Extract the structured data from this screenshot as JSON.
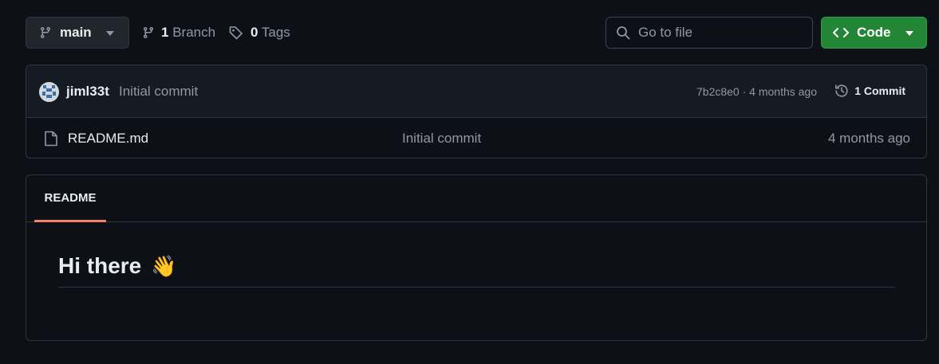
{
  "toolbar": {
    "branch": "main",
    "branches_count": "1",
    "branches_label": "Branch",
    "tags_count": "0",
    "tags_label": "Tags",
    "search_placeholder": "Go to file",
    "code_label": "Code"
  },
  "latest_commit": {
    "author": "jiml33t",
    "message": "Initial commit",
    "meta": "7b2c8e0 · 4 months ago",
    "count_label": "1 Commit"
  },
  "files": [
    {
      "name": "README.md",
      "commit": "Initial commit",
      "time": "4 months ago"
    }
  ],
  "readme": {
    "tab_label": "README",
    "heading": "Hi there",
    "emoji": "👋"
  },
  "colors": {
    "background": "#0d1117",
    "accent_green": "#238636",
    "tab_underline": "#f78166"
  }
}
